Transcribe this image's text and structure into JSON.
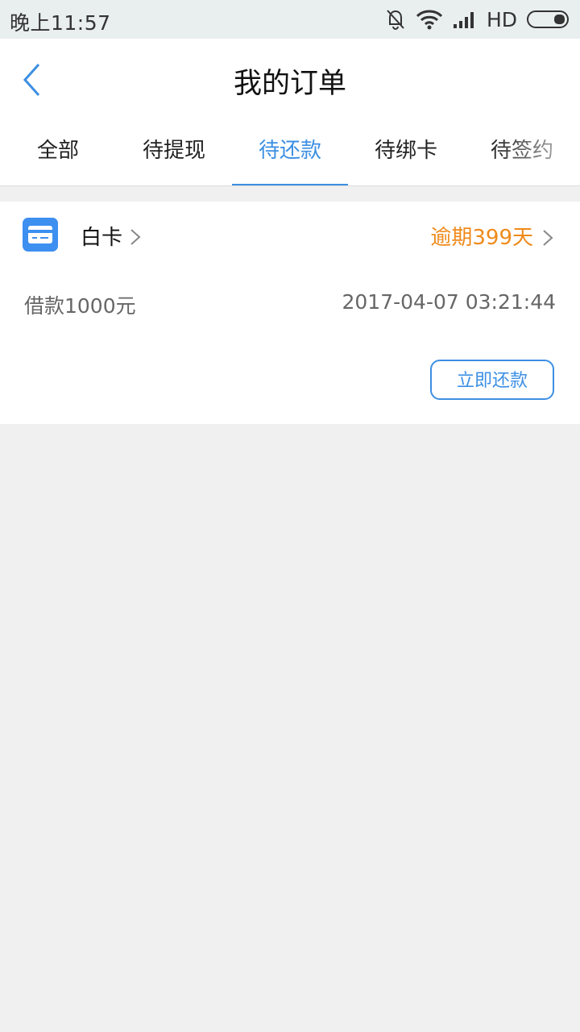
{
  "status_bar": {
    "time": "晚上11:57",
    "network_label": "HD",
    "icons": [
      "mute-bell-icon",
      "wifi-icon",
      "signal-icon",
      "battery-icon"
    ]
  },
  "header": {
    "back_icon": "chevron-left-icon",
    "title": "我的订单"
  },
  "tabs": [
    {
      "label": "全部",
      "active": false
    },
    {
      "label": "待提现",
      "active": false
    },
    {
      "label": "待还款",
      "active": true
    },
    {
      "label": "待绑卡",
      "active": false
    },
    {
      "label": "待签约",
      "active": false
    }
  ],
  "order": {
    "product_icon": "card-icon",
    "product_name": "白卡",
    "overdue_text": "逾期399天",
    "loan_text": "借款1000元",
    "datetime": "2017-04-07 03:21:44",
    "repay_button_label": "立即还款"
  },
  "colors": {
    "accent": "#3c8fe3",
    "warning": "#ef8a1a",
    "background": "#f0f0f0"
  }
}
